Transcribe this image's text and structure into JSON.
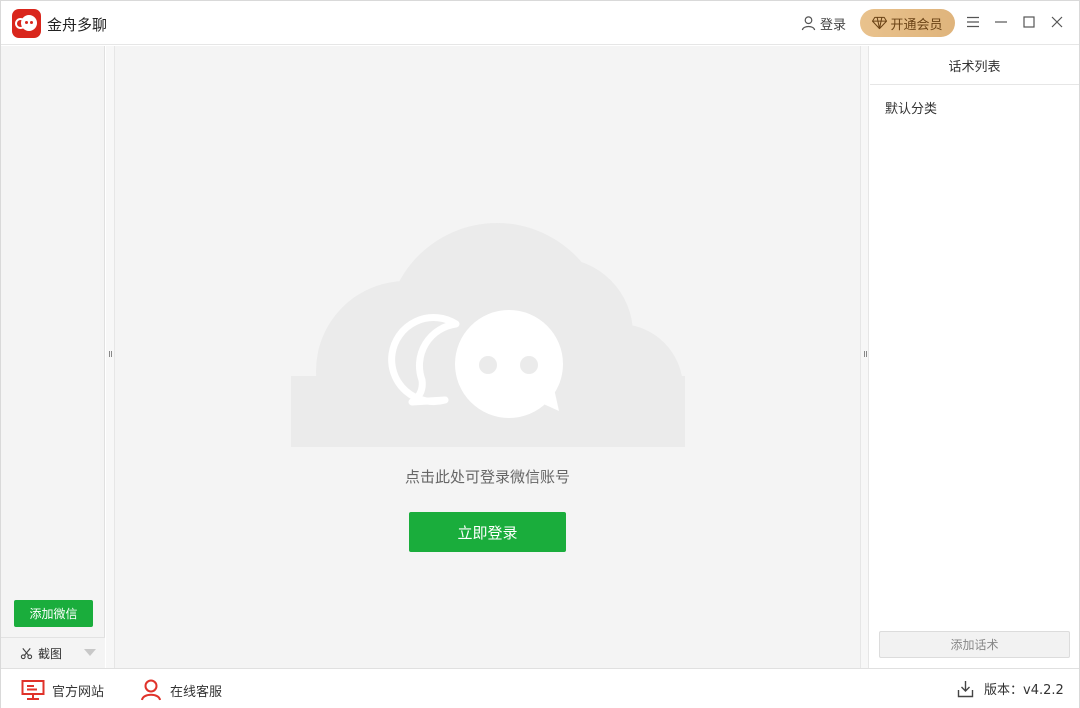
{
  "app": {
    "title": "金舟多聊",
    "logo_icon": "chat-bubbles-logo",
    "brand_color": "#d9261c"
  },
  "titlebar": {
    "login_label": "登录",
    "vip_label": "开通会员",
    "menu_icon": "menu-icon",
    "minimize_icon": "minimize-icon",
    "maximize_icon": "maximize-icon",
    "close_icon": "close-icon"
  },
  "left_panel": {
    "add_wechat_label": "添加微信",
    "screenshot_label": "截图"
  },
  "main": {
    "prompt": "点击此处可登录微信账号",
    "login_button_label": "立即登录",
    "accent_color": "#1aad3c"
  },
  "right_panel": {
    "header": "话术列表",
    "categories": [
      "默认分类"
    ],
    "add_script_label": "添加话术"
  },
  "footer": {
    "website_label": "官方网站",
    "support_label": "在线客服",
    "version_label": "版本：",
    "version_value": "v4.2.2"
  }
}
